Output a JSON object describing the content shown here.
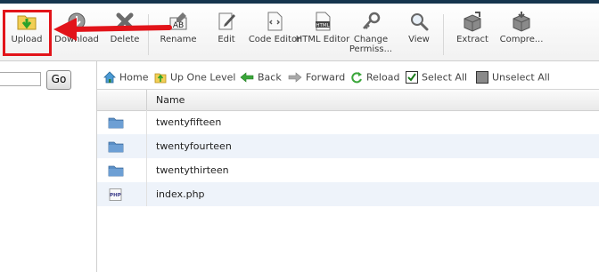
{
  "toolbar": {
    "items": [
      {
        "label": "Upload",
        "icon": "upload-icon"
      },
      {
        "label": "Download",
        "icon": "download-icon"
      },
      {
        "label": "Delete",
        "icon": "delete-icon"
      },
      {
        "label": "Rename",
        "icon": "rename-icon"
      },
      {
        "label": "Edit",
        "icon": "edit-icon"
      },
      {
        "label": "Code Editor",
        "icon": "code-editor-icon"
      },
      {
        "label": "HTML Editor",
        "icon": "html-editor-icon"
      },
      {
        "label": "Change Permiss...",
        "icon": "permissions-icon"
      },
      {
        "label": "View",
        "icon": "view-icon"
      },
      {
        "label": "Extract",
        "icon": "extract-icon"
      },
      {
        "label": "Compre...",
        "icon": "compress-icon"
      }
    ],
    "html_icon_text": "HTML",
    "rename_icon_text": "AB"
  },
  "left": {
    "search_value": "",
    "go_label": "Go"
  },
  "nav": {
    "home": "Home",
    "up_one_level": "Up One Level",
    "back": "Back",
    "forward": "Forward",
    "reload": "Reload",
    "select_all": "Select All",
    "unselect_all": "Unselect All"
  },
  "table": {
    "header_name": "Name",
    "rows": [
      {
        "name": "twentyfifteen",
        "type": "folder"
      },
      {
        "name": "twentyfourteen",
        "type": "folder"
      },
      {
        "name": "twentythirteen",
        "type": "folder"
      },
      {
        "name": "index.php",
        "type": "php",
        "icon_text": "PHP"
      }
    ]
  },
  "colors": {
    "highlight": "#e2141a",
    "arrow": "#e2141a",
    "row_alt": "#eef3fa",
    "top_strip": "#16364f"
  }
}
